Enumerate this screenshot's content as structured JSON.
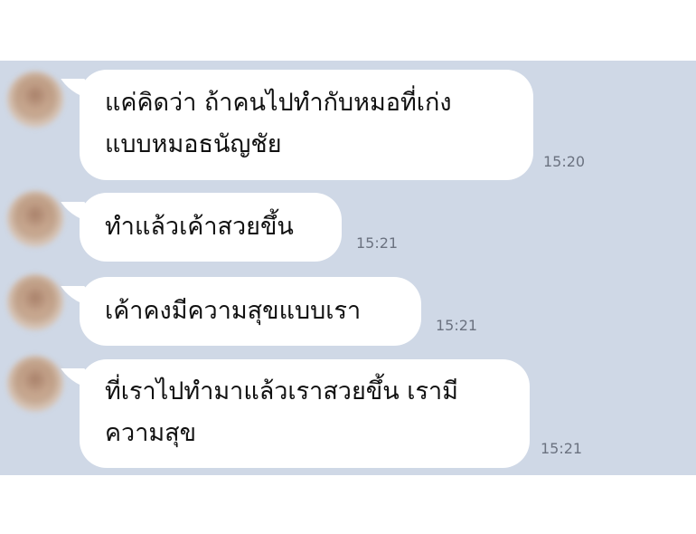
{
  "messages": [
    {
      "lines": [
        "แค่คิดว่า ถ้าคนไปทำกับหมอที่เก่ง",
        "แบบหมอธนัญชัย"
      ],
      "time": "15:20"
    },
    {
      "lines": [
        "ทำแล้วเค้าสวยขึ้น"
      ],
      "time": "15:21"
    },
    {
      "lines": [
        "เค้าคงมีความสุขแบบเรา"
      ],
      "time": "15:21"
    },
    {
      "lines": [
        "ที่เราไปทำมาแล้วเราสวยขึ้น เรามี",
        "ความสุข"
      ],
      "time": "15:21"
    }
  ]
}
